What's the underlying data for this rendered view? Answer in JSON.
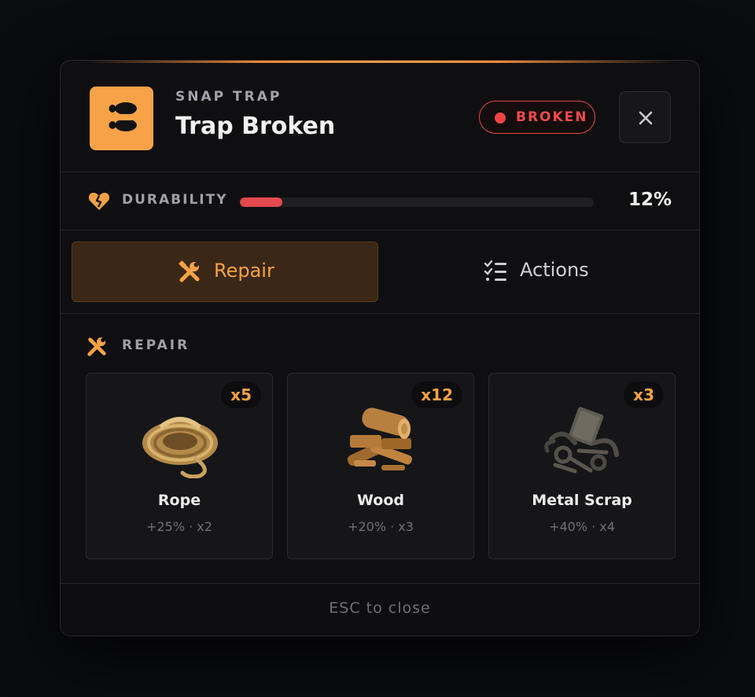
{
  "header": {
    "kicker": "SNAP TRAP",
    "title": "Trap Broken",
    "status": "BROKEN",
    "icon": "footprints-icon",
    "close_icon": "close-icon",
    "accent": "#f7a246",
    "status_color": "#ef4444"
  },
  "durability": {
    "label": "DURABILITY",
    "value": "12%",
    "fraction": 0.12,
    "icon": "broken-heart-icon"
  },
  "tabs": [
    {
      "label": "Repair",
      "icon": "tools-icon",
      "active": true
    },
    {
      "label": "Actions",
      "icon": "checklist-icon",
      "active": false
    }
  ],
  "section": {
    "label": "REPAIR",
    "icon": "tools-icon"
  },
  "materials": [
    {
      "name": "Rope",
      "qty": "x5",
      "meta": "+25% · x2",
      "icon": "rope-icon"
    },
    {
      "name": "Wood",
      "qty": "x12",
      "meta": "+20% · x3",
      "icon": "wood-logs-icon"
    },
    {
      "name": "Metal Scrap",
      "qty": "x3",
      "meta": "+40% · x4",
      "icon": "metal-scrap-icon"
    }
  ],
  "footer": {
    "hint": "ESC to close"
  }
}
